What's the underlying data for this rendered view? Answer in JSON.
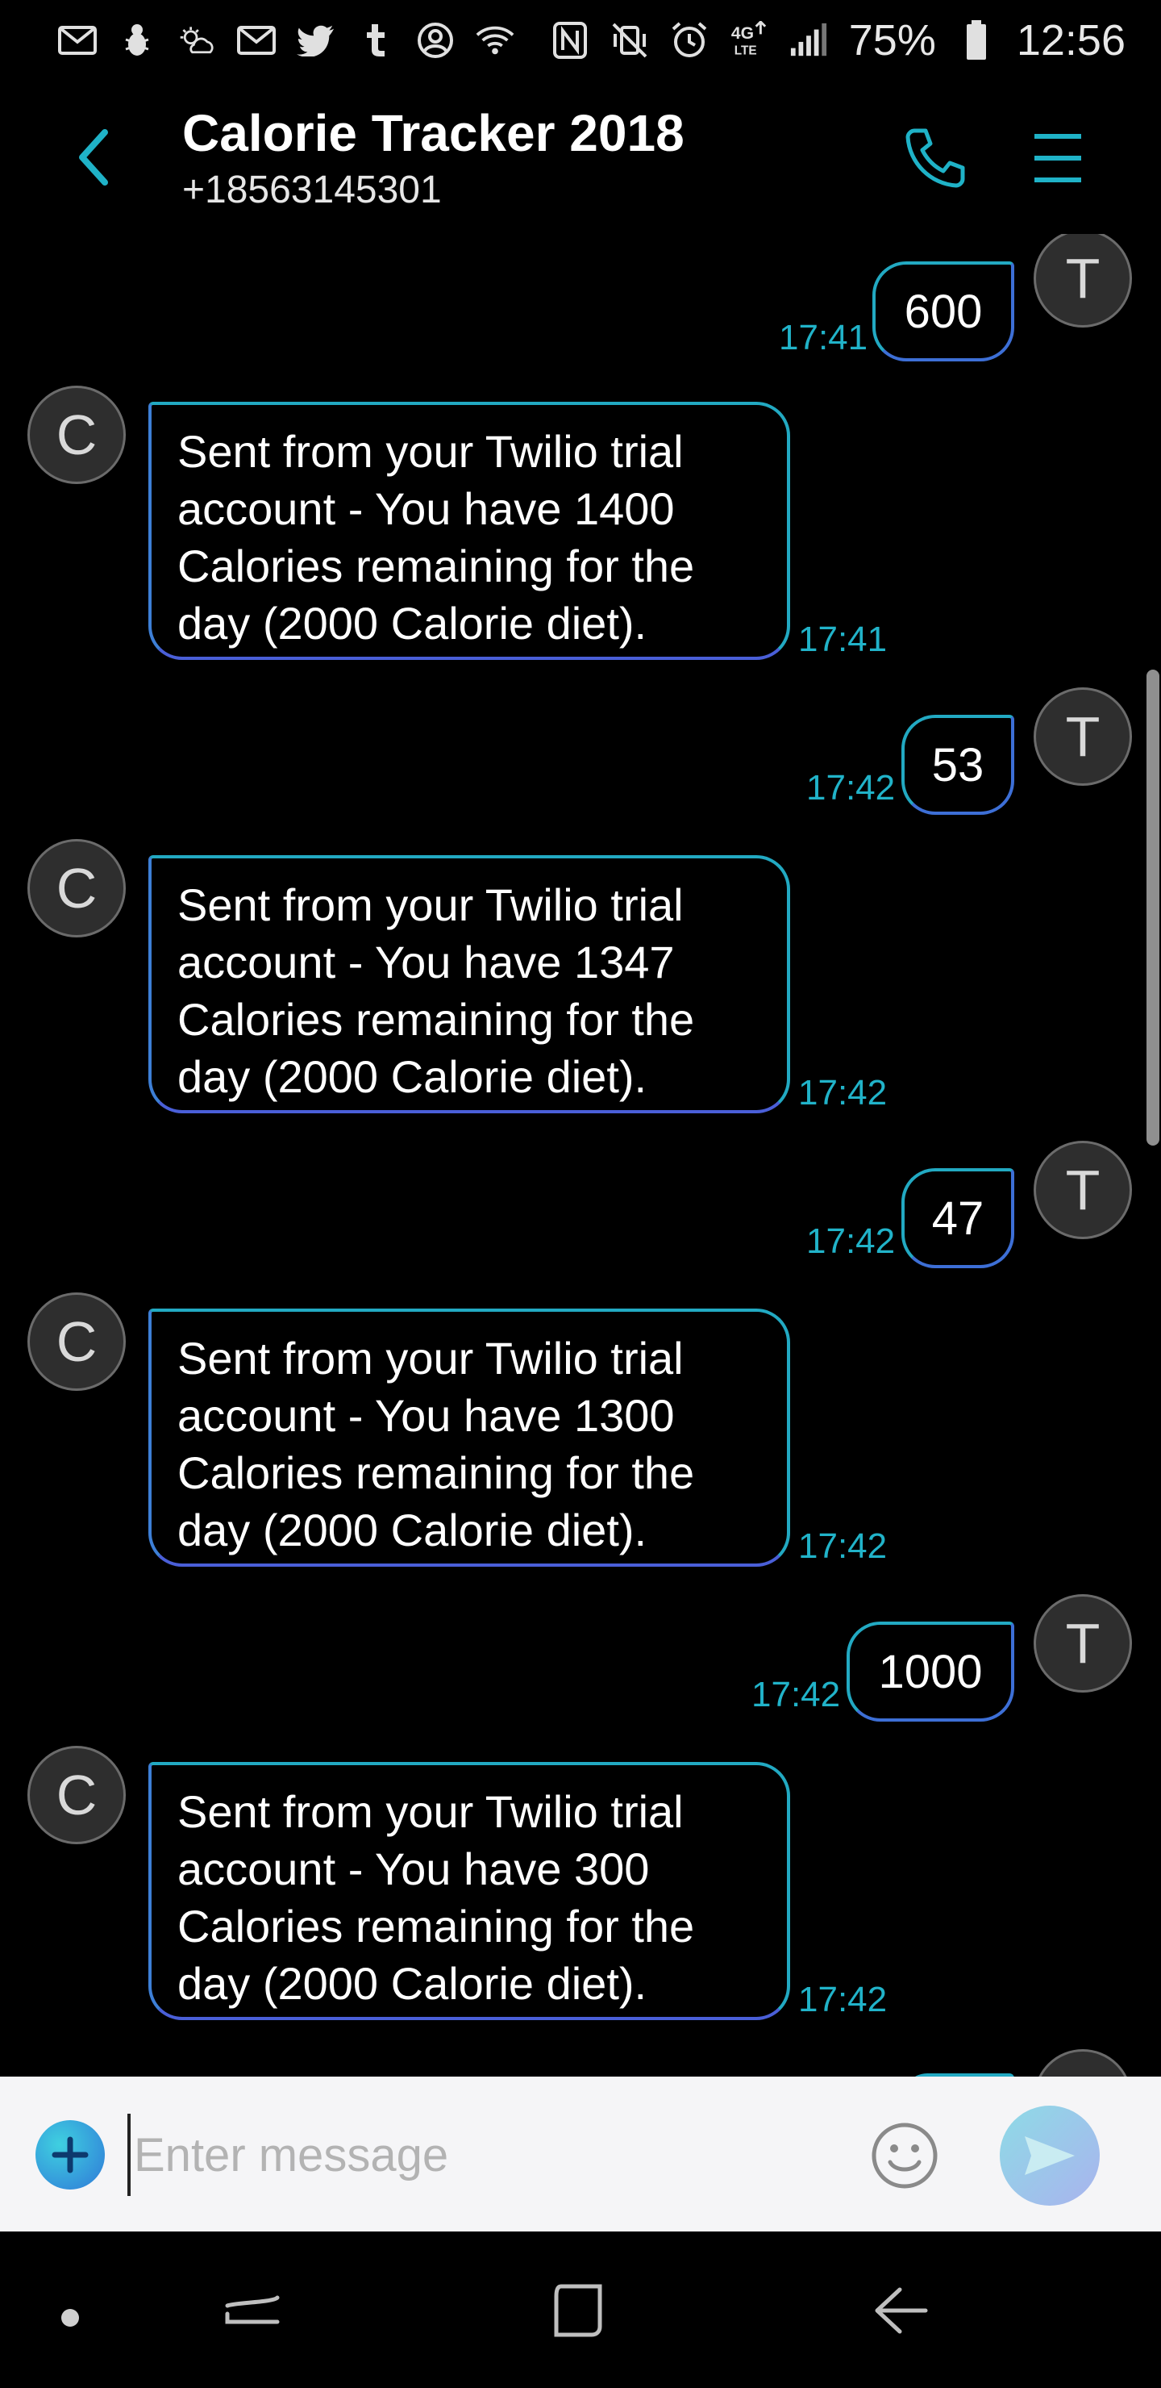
{
  "status_bar": {
    "battery_text": "75%",
    "clock": "12:56",
    "left_icons": [
      "gmail-icon",
      "bug-icon",
      "weather-icon",
      "gmail-icon",
      "twitter-icon",
      "tumblr-icon",
      "account-icon",
      "wifi-icon"
    ],
    "right_icons": [
      "nfc-icon",
      "vibrate-icon",
      "alarm-icon",
      "4g-lte-icon",
      "signal-icon"
    ]
  },
  "header": {
    "contact_name": "Calorie Tracker 2018",
    "contact_number": "+18563145301"
  },
  "conversation": {
    "messages": [
      {
        "direction": "out",
        "text": "600",
        "time": "17:41",
        "avatar": "T"
      },
      {
        "direction": "in",
        "lines": [
          "Sent from your Twilio trial",
          "account - You have 1400",
          "Calories remaining for the",
          "day (2000 Calorie diet)."
        ],
        "time": "17:41",
        "avatar": "C"
      },
      {
        "direction": "out",
        "text": "53",
        "time": "17:42",
        "avatar": "T"
      },
      {
        "direction": "in",
        "lines": [
          "Sent from your Twilio trial",
          "account - You have 1347",
          "Calories remaining for the",
          "day (2000 Calorie diet)."
        ],
        "time": "17:42",
        "avatar": "C"
      },
      {
        "direction": "out",
        "text": "47",
        "time": "17:42",
        "avatar": "T"
      },
      {
        "direction": "in",
        "lines": [
          "Sent from your Twilio trial",
          "account - You have 1300",
          "Calories remaining for the",
          "day (2000 Calorie diet)."
        ],
        "time": "17:42",
        "avatar": "C"
      },
      {
        "direction": "out",
        "text": "1000",
        "time": "17:42",
        "avatar": "T"
      },
      {
        "direction": "in",
        "lines": [
          "Sent from your Twilio trial",
          "account - You have 300",
          "Calories remaining for the",
          "day (2000 Calorie diet)."
        ],
        "time": "17:42",
        "avatar": "C"
      }
    ]
  },
  "composer": {
    "placeholder": "Enter message"
  },
  "colors": {
    "accent": "#21b3c9",
    "bubble_border_start": "#22a9c2",
    "bubble_border_end": "#4a5fd8",
    "background": "#000000",
    "composer_bg": "#f5f5f7"
  }
}
